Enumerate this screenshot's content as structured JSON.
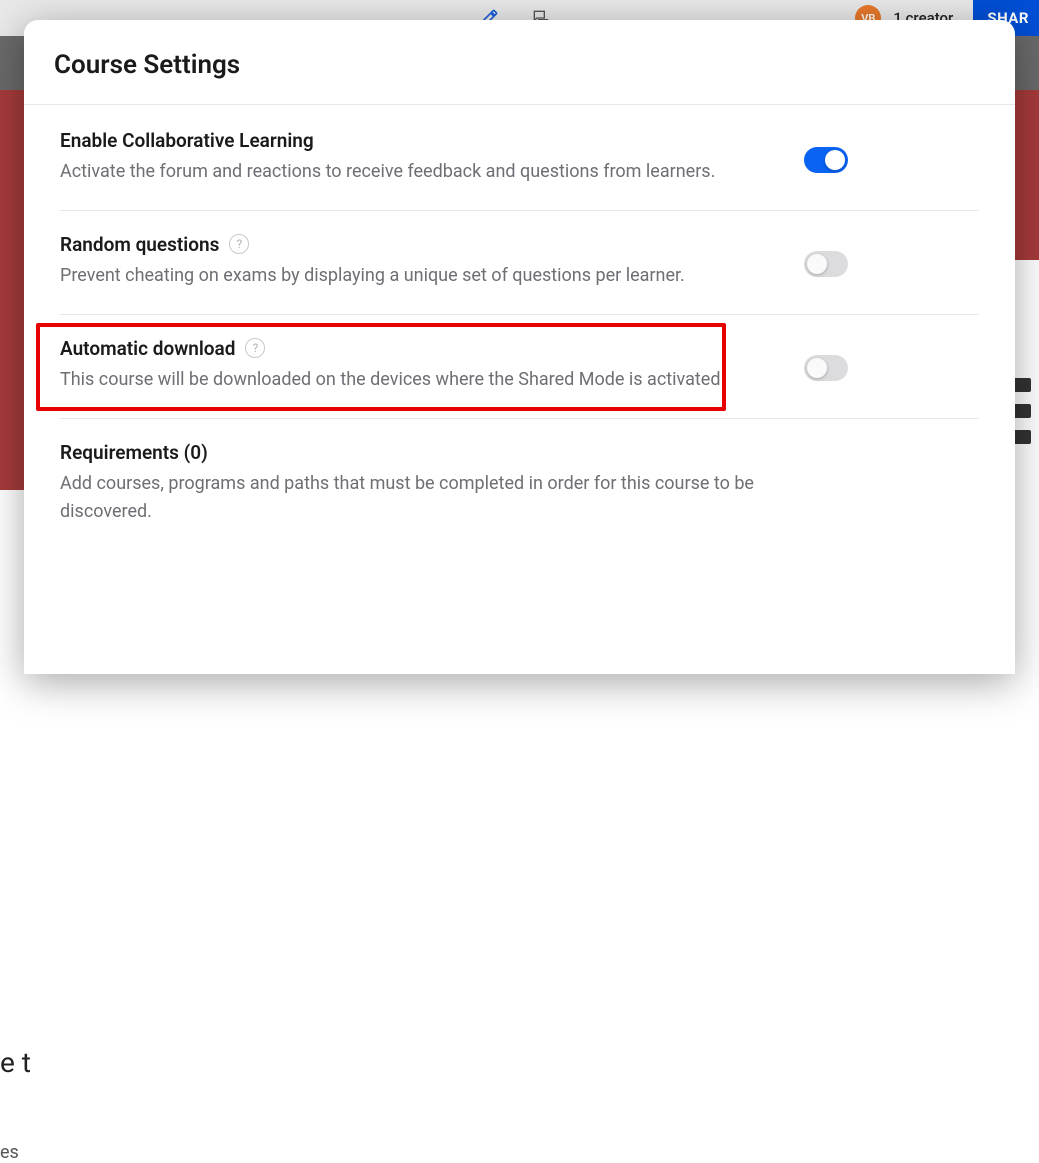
{
  "background": {
    "avatar_initials": "VB",
    "creator_count_label": "1 creator",
    "share_label": "SHAR",
    "partial_text_1": "e t",
    "partial_text_2": "es"
  },
  "modal": {
    "title": "Course Settings"
  },
  "settings": {
    "collaborative": {
      "title": "Enable Collaborative Learning",
      "desc": "Activate the forum and reactions to receive feedback and questions from learners.",
      "enabled": true
    },
    "random_questions": {
      "title": "Random questions",
      "desc": "Prevent cheating on exams by displaying a unique set of questions per learner.",
      "enabled": false,
      "has_help": true
    },
    "automatic_download": {
      "title": "Automatic download",
      "desc": "This course will be downloaded on the devices where the Shared Mode is activated.",
      "enabled": false,
      "has_help": true
    },
    "requirements": {
      "title": "Requirements (0)",
      "desc": "Add courses, programs and paths that must be completed in order for this course to be discovered."
    }
  }
}
